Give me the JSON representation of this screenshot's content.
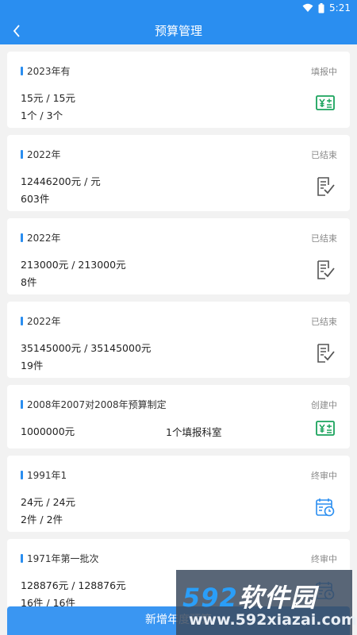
{
  "status_bar": {
    "time": "5:21"
  },
  "header": {
    "title": "预算管理"
  },
  "cards": [
    {
      "name": "2023年有",
      "status": "填报中",
      "line1": "15元 / 15元",
      "line2": "1个 / 3个",
      "icon": "budget-yen-icon"
    },
    {
      "name": "2022年",
      "status": "已结束",
      "line1": "12446200元 / 元",
      "line2": "603件",
      "icon": "document-check-icon"
    },
    {
      "name": "2022年",
      "status": "已结束",
      "line1": "213000元 / 213000元",
      "line2": "8件",
      "icon": "document-check-icon"
    },
    {
      "name": "2022年",
      "status": "已结束",
      "line1": "35145000元 / 35145000元",
      "line2": "19件",
      "icon": "document-check-icon"
    },
    {
      "name": "2008年2007对2008年预算制定",
      "status": "创建中",
      "line1": "1000000元",
      "line_mid": "1个填报科室",
      "icon": "budget-yen-icon"
    },
    {
      "name": "1991年1",
      "status": "终审中",
      "line1": "24元 / 24元",
      "line2": "2件 / 2件",
      "icon": "calendar-clock-icon"
    },
    {
      "name": "1971年第一批次",
      "status": "终审中",
      "line1": "128876元 / 128876元",
      "line2": "16件 / 16件",
      "icon": "calendar-clock-icon"
    }
  ],
  "bottom_button": {
    "label": "新增年度预算"
  },
  "watermark": {
    "brand_num": "592",
    "brand_text": "软件园",
    "url": "www.592xiazai.com"
  },
  "colors": {
    "primary": "#2a8ef0",
    "green_icon": "#1aa35c",
    "gray_icon": "#555555",
    "blue_icon": "#2a8ef0"
  }
}
